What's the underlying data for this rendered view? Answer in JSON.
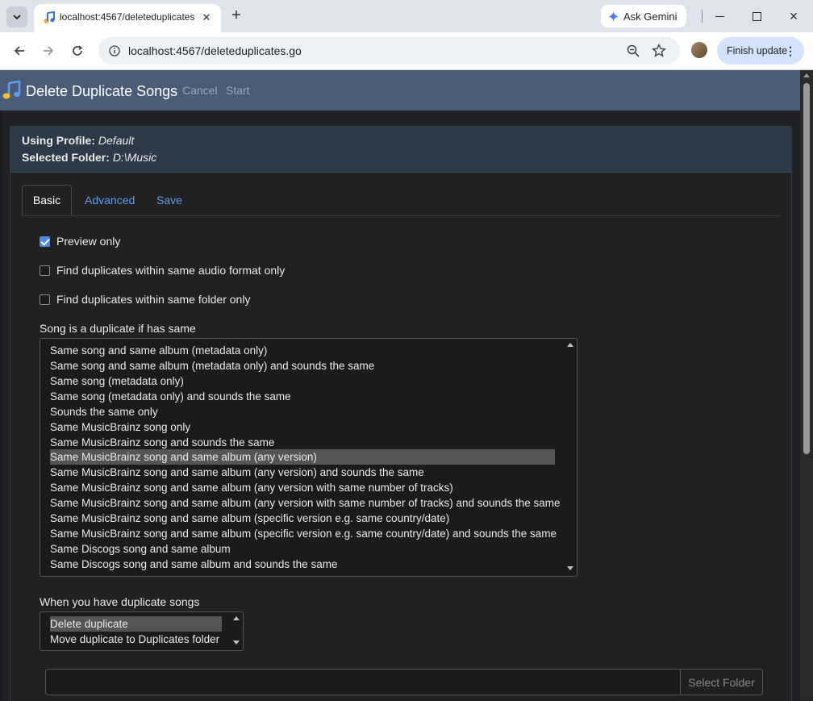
{
  "browser": {
    "tab_title": "localhost:4567/deleteduplicates",
    "ask_gemini": "Ask Gemini",
    "url": "localhost:4567/deleteduplicates.go",
    "finish_update": "Finish update"
  },
  "app": {
    "title": "Delete Duplicate Songs",
    "cancel": "Cancel",
    "start": "Start",
    "profile_label": "Using Profile:",
    "profile_value": "Default",
    "folder_label": "Selected Folder:",
    "folder_value": "D:\\Music",
    "tabs": [
      "Basic",
      "Advanced",
      "Save"
    ],
    "checkboxes": [
      {
        "label": "Preview only",
        "checked": true
      },
      {
        "label": "Find duplicates within same audio format only",
        "checked": false
      },
      {
        "label": "Find duplicates within same folder only",
        "checked": false
      }
    ],
    "duplicate_rule_label": "Song is a duplicate if has same",
    "duplicate_rules": [
      "Same song and same album (metadata only)",
      "Same song and same album (metadata only) and sounds the same",
      "Same song (metadata only)",
      "Same song (metadata only) and sounds the same",
      "Sounds the same only",
      "Same MusicBrainz song only",
      "Same MusicBrainz song and sounds the same",
      "Same MusicBrainz song and same album (any version)",
      "Same MusicBrainz song and same album (any version) and sounds the same",
      "Same MusicBrainz song and same album (any version with same number of tracks)",
      "Same MusicBrainz song and same album (any version with same number of tracks) and sounds the same",
      "Same MusicBrainz song and same album (specific version e.g. same country/date)",
      "Same MusicBrainz song and same album (specific version e.g. same country/date) and sounds the same",
      "Same Discogs song and same album",
      "Same Discogs song and same album and sounds the same"
    ],
    "duplicate_rule_selected": "Same MusicBrainz song and same album (any version)",
    "action_label": "When you have duplicate songs",
    "actions": [
      "Delete duplicate",
      "Move duplicate to Duplicates folder"
    ],
    "action_selected": "Delete duplicate",
    "folder_input_value": "",
    "select_folder": "Select Folder"
  },
  "colors": {
    "app_header": "#4a5d78",
    "info_box": "#2c3a48",
    "link_blue": "#5b9bf1",
    "checkbox_blue": "#4a89f3",
    "finish_update_bg": "#d3e3fd"
  }
}
